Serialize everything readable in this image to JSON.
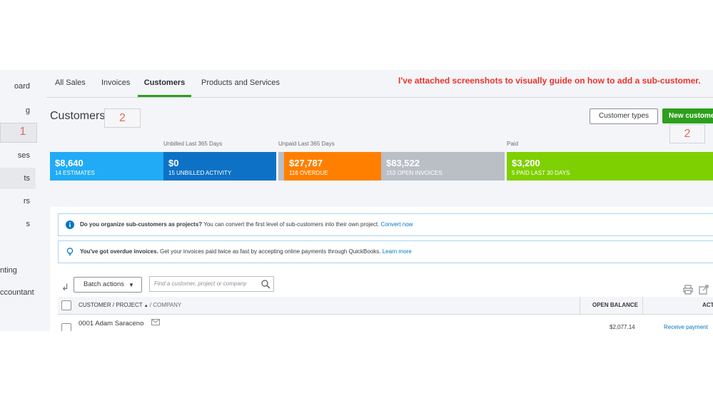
{
  "sidebar": {
    "items": [
      {
        "label": "oard"
      },
      {
        "label": "g"
      },
      {
        "label": ""
      },
      {
        "label": "ses"
      },
      {
        "label": "ts"
      },
      {
        "label": "rs"
      },
      {
        "label": "s"
      },
      {
        "label": "nting"
      },
      {
        "label": "ccountant"
      }
    ]
  },
  "tabs": [
    {
      "label": "All Sales"
    },
    {
      "label": "Invoices"
    },
    {
      "label": "Customers"
    },
    {
      "label": "Products and Services"
    }
  ],
  "annotation": {
    "note": "I've attached screenshots to visually guide on how to add a sub-customer.",
    "step_sidebar": "1",
    "step_title": "2",
    "step_button": "2"
  },
  "page": {
    "title": "Customers",
    "customer_types_label": "Customer types",
    "new_customer_label": "New customer"
  },
  "summary": {
    "unbilled_label": "Unbilled Last 365 Days",
    "unpaid_label": "Unpaid Last 365 Days",
    "paid_label": "Paid",
    "bars": [
      {
        "amount": "$8,640",
        "label": "14 ESTIMATES",
        "color": "#21abf6"
      },
      {
        "amount": "$0",
        "label": "15 UNBILLED ACTIVITY",
        "color": "#0d72c6"
      },
      {
        "amount": "$27,787",
        "label": "116 OVERDUE",
        "color": "#ff8000"
      },
      {
        "amount": "$83,522",
        "label": "153 OPEN INVOICES",
        "color": "#babec5"
      },
      {
        "amount": "$3,200",
        "label": "5 PAID LAST 30 DAYS",
        "color": "#7fd000"
      }
    ]
  },
  "banners": [
    {
      "bold": "Do you organize sub-customers as projects?",
      "text": " You can convert the first level of sub-customers into their own project. ",
      "link": "Convert now"
    },
    {
      "bold": "You've got overdue invoices.",
      "text": " Get your invoices paid twice as fast by accepting online payments through QuickBooks. ",
      "link": "Learn more"
    }
  ],
  "toolbar": {
    "batch_label": "Batch actions",
    "search_placeholder": "Find a customer, project or company"
  },
  "table": {
    "col_customer": "CUSTOMER / PROJECT",
    "col_company": "/ COMPANY",
    "col_balance": "OPEN BALANCE",
    "col_action": "ACTI",
    "rows": [
      {
        "name": "0001 Adam Saraceno",
        "balance": "$2,077.14",
        "action": "Receive payment"
      }
    ]
  }
}
